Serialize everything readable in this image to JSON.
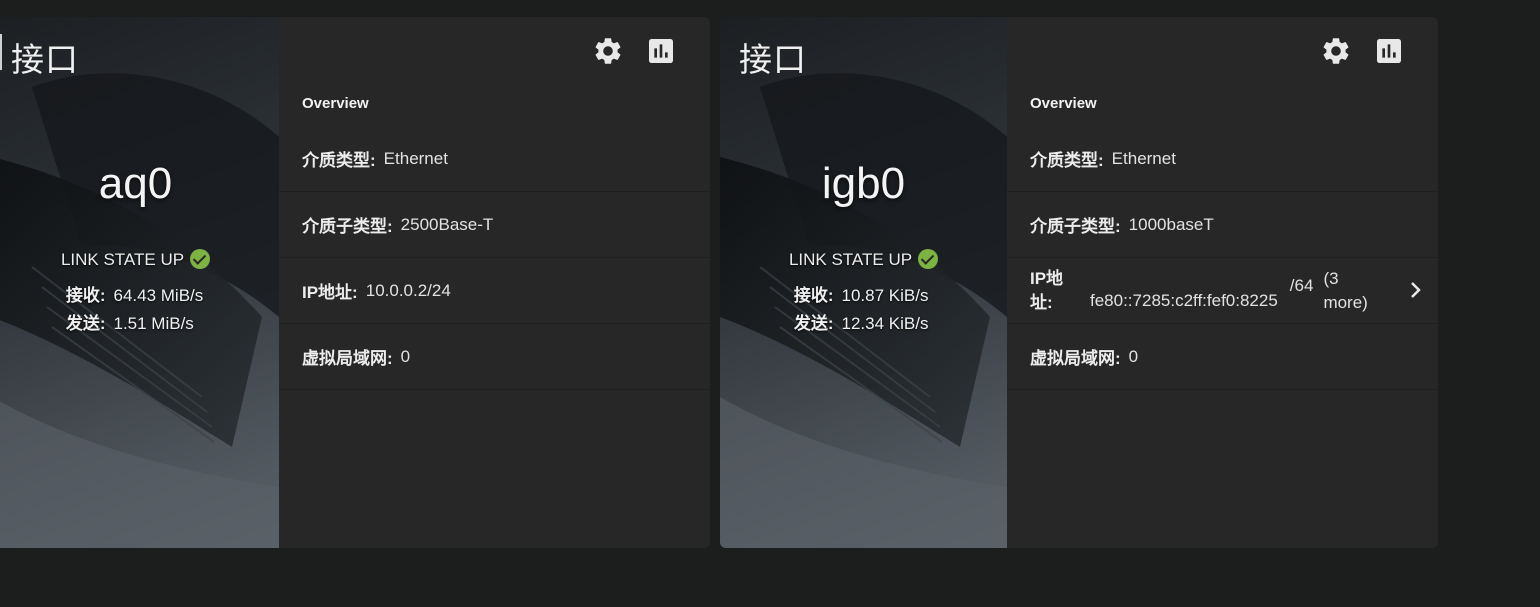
{
  "cards": [
    {
      "title": "接口",
      "iface": "aq0",
      "link_state": "LINK STATE UP",
      "rx_label": "接收:",
      "rx_value": "64.43 MiB/s",
      "tx_label": "发送:",
      "tx_value": "1.51 MiB/s",
      "overview": "Overview",
      "rows": {
        "media_label": "介质类型:",
        "media_value": "Ethernet",
        "subtype_label": "介质子类型:",
        "subtype_value": "2500Base-T",
        "ip_label": "IP地址:",
        "ip_value": "10.0.0.2/24",
        "vlan_label": "虚拟局域网:",
        "vlan_value": "0"
      }
    },
    {
      "title": "接口",
      "iface": "igb0",
      "link_state": "LINK STATE UP",
      "rx_label": "接收:",
      "rx_value": "10.87 KiB/s",
      "tx_label": "发送:",
      "tx_value": "12.34 KiB/s",
      "overview": "Overview",
      "rows": {
        "media_label": "介质类型:",
        "media_value": "Ethernet",
        "subtype_label": "介质子类型:",
        "subtype_value": "1000baseT",
        "ip_label": "IP地址:",
        "ip_value": "fe80::7285:c2ff:fef0:8225",
        "ip_prefix": "/64",
        "ip_more": "(3 more)",
        "vlan_label": "虚拟局域网:",
        "vlan_value": "0"
      }
    }
  ],
  "icons": {
    "settings": "gear-icon",
    "stats": "bar-chart-icon",
    "status": "check-circle-icon",
    "expand": "chevron-right-icon"
  },
  "colors": {
    "status_ok": "#7cb342",
    "card_bg": "#272727",
    "page_bg": "#1c1d1d"
  }
}
